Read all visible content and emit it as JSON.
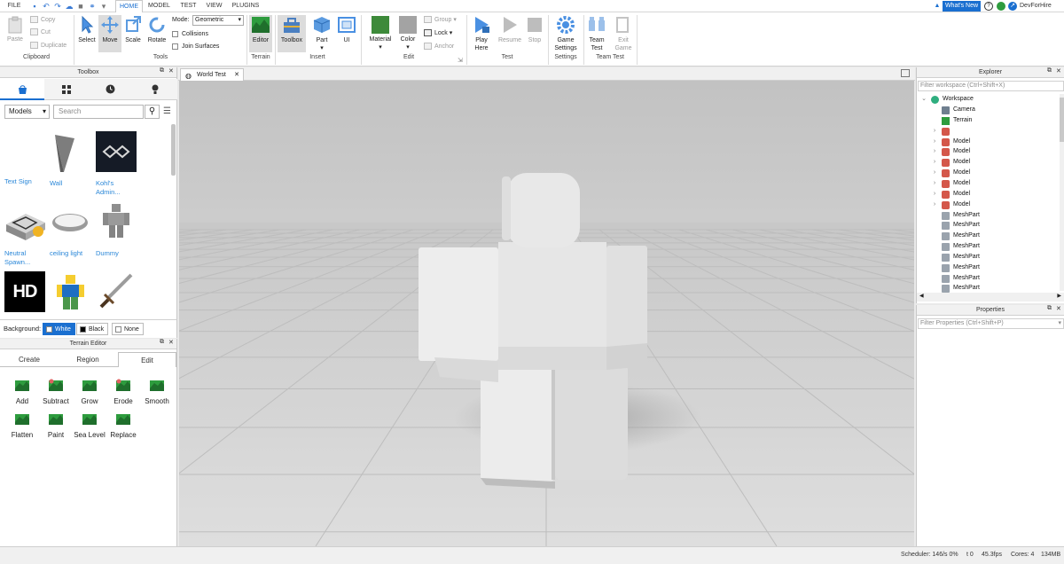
{
  "menu": {
    "file": "FILE",
    "tabs": [
      "HOME",
      "MODEL",
      "TEST",
      "VIEW",
      "PLUGINS"
    ],
    "whats_new": "What's New",
    "username": "DevForHire"
  },
  "ribbon": {
    "clipboard": {
      "paste": "Paste",
      "copy": "Copy",
      "cut": "Cut",
      "duplicate": "Duplicate",
      "group_label": "Clipboard"
    },
    "tools": {
      "select": "Select",
      "move": "Move",
      "scale": "Scale",
      "rotate": "Rotate",
      "group_label": "Tools"
    },
    "mode": {
      "label": "Mode:",
      "value": "Geometric",
      "collisions": "Collisions",
      "join_surfaces": "Join Surfaces"
    },
    "terrain": {
      "editor": "Editor",
      "group_label": "Terrain"
    },
    "insert": {
      "toolbox": "Toolbox",
      "part": "Part",
      "ui": "UI",
      "group_label": "Insert"
    },
    "edit": {
      "material": "Material",
      "color": "Color",
      "group": "Group",
      "lock": "Lock",
      "anchor": "Anchor",
      "group_label": "Edit"
    },
    "test": {
      "play_here": [
        "Play",
        "Here"
      ],
      "resume": "Resume",
      "stop": "Stop",
      "group_label": "Test"
    },
    "settings": {
      "game_settings": [
        "Game",
        "Settings"
      ],
      "group_label": "Settings"
    },
    "team_test": {
      "team_test": [
        "Team",
        "Test"
      ],
      "exit_game": [
        "Exit",
        "Game"
      ],
      "group_label": "Team Test"
    }
  },
  "toolbox": {
    "title": "Toolbox",
    "category": "Models",
    "search_placeholder": "Search",
    "items": [
      {
        "label": "Text Sign",
        "label2": ""
      },
      {
        "label": "Wall",
        "label2": ""
      },
      {
        "label": "Kohl's",
        "label2": "Admin..."
      },
      {
        "label": "Neutral",
        "label2": "Spawn..."
      },
      {
        "label": "ceiling light",
        "label2": ""
      },
      {
        "label": "Dummy",
        "label2": ""
      },
      {
        "label": "HD",
        "label2": ""
      }
    ],
    "background": {
      "label": "Background:",
      "options": [
        "White",
        "Black",
        "None"
      ],
      "selected": "White"
    }
  },
  "terrain_editor": {
    "title": "Terrain Editor",
    "tabs": [
      "Create",
      "Region",
      "Edit"
    ],
    "active_tab": "Edit",
    "tools": [
      "Add",
      "Subtract",
      "Grow",
      "Erode",
      "Smooth",
      "Flatten",
      "Paint",
      "Sea Level",
      "Replace"
    ]
  },
  "viewport": {
    "tab": "World Test"
  },
  "explorer": {
    "title": "Explorer",
    "filter_placeholder": "Filter workspace (Ctrl+Shift+X)",
    "workspace": "Workspace",
    "children": [
      {
        "name": "Camera",
        "icon": "camera-icon",
        "expandable": false
      },
      {
        "name": "Terrain",
        "icon": "terrain-icon",
        "expandable": false
      },
      {
        "name": "",
        "icon": "model-icon",
        "expandable": true
      },
      {
        "name": "Model",
        "icon": "model-icon",
        "expandable": true
      },
      {
        "name": "Model",
        "icon": "model-icon",
        "expandable": true
      },
      {
        "name": "Model",
        "icon": "model-icon",
        "expandable": true
      },
      {
        "name": "Model",
        "icon": "model-icon",
        "expandable": true
      },
      {
        "name": "Model",
        "icon": "model-icon",
        "expandable": true
      },
      {
        "name": "Model",
        "icon": "model-icon",
        "expandable": true
      },
      {
        "name": "Model",
        "icon": "model-icon",
        "expandable": true
      },
      {
        "name": "MeshPart",
        "icon": "meshpart-icon",
        "expandable": false
      },
      {
        "name": "MeshPart",
        "icon": "meshpart-icon",
        "expandable": false
      },
      {
        "name": "MeshPart",
        "icon": "meshpart-icon",
        "expandable": false
      },
      {
        "name": "MeshPart",
        "icon": "meshpart-icon",
        "expandable": false
      },
      {
        "name": "MeshPart",
        "icon": "meshpart-icon",
        "expandable": false
      },
      {
        "name": "MeshPart",
        "icon": "meshpart-icon",
        "expandable": false
      },
      {
        "name": "MeshPart",
        "icon": "meshpart-icon",
        "expandable": false
      },
      {
        "name": "MeshPart",
        "icon": "meshpart-icon",
        "expandable": false
      }
    ]
  },
  "properties": {
    "title": "Properties",
    "filter_placeholder": "Filter Properties (Ctrl+Shift+P)"
  },
  "statusbar": {
    "scheduler": "Scheduler: 146/s 0%",
    "t": "t 0",
    "fps": "45.3fps",
    "cores": "Cores: 4",
    "memory": "134MB"
  },
  "colors": {
    "accent": "#1a6fd0",
    "terrain_green": "#2e9c3e",
    "material_green": "#3d8a3a",
    "color_gray": "#a3a3a3"
  }
}
